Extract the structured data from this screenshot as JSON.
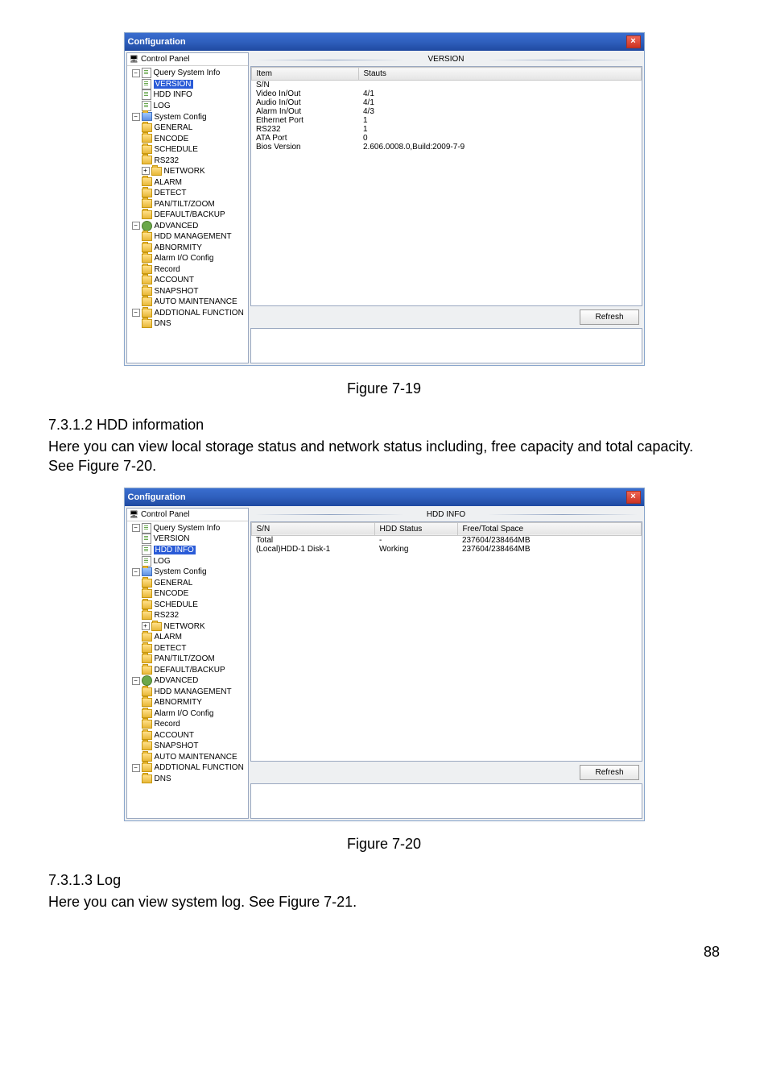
{
  "figure1": {
    "window_title": "Configuration",
    "cp_label": "Control Panel",
    "section_title": "VERSION",
    "tree": {
      "root": "Query System Info",
      "qsi": [
        "VERSION",
        "HDD INFO",
        "LOG"
      ],
      "syscfg_label": "System Config",
      "syscfg": [
        "GENERAL",
        "ENCODE",
        "SCHEDULE",
        "RS232",
        "NETWORK",
        "ALARM",
        "DETECT",
        "PAN/TILT/ZOOM",
        "DEFAULT/BACKUP"
      ],
      "adv_label": "ADVANCED",
      "adv": [
        "HDD MANAGEMENT",
        "ABNORMITY",
        "Alarm I/O Config",
        "Record",
        "ACCOUNT",
        "SNAPSHOT",
        "AUTO MAINTENANCE"
      ],
      "addl_label": "ADDTIONAL FUNCTION",
      "addl": [
        "DNS"
      ],
      "selected": "VERSION"
    },
    "table": {
      "headers": [
        "Item",
        "Stauts"
      ],
      "rows": [
        [
          "S/N",
          ""
        ],
        [
          "Video In/Out",
          "4/1"
        ],
        [
          "Audio In/Out",
          "4/1"
        ],
        [
          "Alarm In/Out",
          "4/3"
        ],
        [
          "Ethernet Port",
          "1"
        ],
        [
          "RS232",
          "1"
        ],
        [
          "ATA Port",
          "0"
        ],
        [
          "Bios Version",
          "2.606.0008.0,Build:2009-7-9"
        ]
      ]
    },
    "refresh": "Refresh",
    "caption": "Figure 7-19"
  },
  "section2": {
    "heading": "7.3.1.2  HDD information",
    "text": "Here you can view local storage status and network status including, free capacity and total capacity. See Figure 7-20."
  },
  "figure2": {
    "window_title": "Configuration",
    "cp_label": "Control Panel",
    "section_title": "HDD INFO",
    "tree": {
      "selected": "HDD INFO"
    },
    "table": {
      "headers": [
        "S/N",
        "HDD Status",
        "Free/Total Space"
      ],
      "rows": [
        [
          "Total",
          "-",
          "237604/238464MB"
        ],
        [
          "(Local)HDD-1 Disk-1",
          "Working",
          "237604/238464MB"
        ]
      ]
    },
    "refresh": "Refresh",
    "caption": "Figure 7-20"
  },
  "section3": {
    "heading": "7.3.1.3  Log",
    "text": "Here you can view system log. See Figure 7-21."
  },
  "pagenum": "88"
}
